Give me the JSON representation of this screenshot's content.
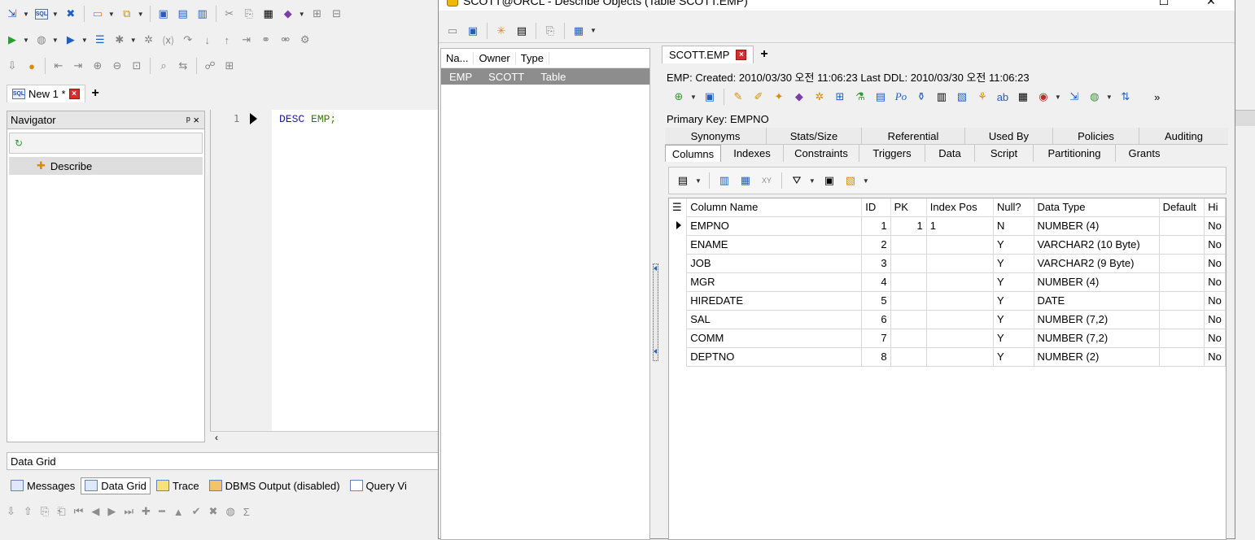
{
  "main": {
    "doc_tab": {
      "label": "New 1 *"
    },
    "navigator": {
      "title": "Navigator",
      "pin": "ᵖ ×",
      "items": [
        {
          "label": "Describe"
        }
      ]
    },
    "editor": {
      "line_number": "1",
      "code_keyword": "DESC",
      "code_table": "EMP;"
    },
    "data_grid_label": "Data Grid",
    "bottom_tabs": [
      {
        "label": "Messages"
      },
      {
        "label": "Data Grid"
      },
      {
        "label": "Trace"
      },
      {
        "label": "DBMS Output (disabled)"
      },
      {
        "label": "Query Vi"
      }
    ]
  },
  "describe_window": {
    "title": "SCOTT@ORCL - Describe Objects (Table SCOTT.EMP)",
    "object_list": {
      "headers": [
        "Na...",
        "Owner",
        "Type"
      ],
      "rows": [
        {
          "name": "EMP",
          "owner": "SCOTT",
          "type": "Table"
        }
      ]
    },
    "object_tab": "SCOTT.EMP",
    "info_line": "EMP:  Created: 2010/03/30 오전 11:06:23  Last DDL: 2010/03/30 오전 11:06:23",
    "primary_key": "Primary Key:  EMPNO",
    "tabs_top": [
      "Synonyms",
      "Stats/Size",
      "Referential",
      "Used By",
      "Policies",
      "Auditing"
    ],
    "tabs_bottom": [
      "Columns",
      "Indexes",
      "Constraints",
      "Triggers",
      "Data",
      "Script",
      "Partitioning",
      "Grants"
    ],
    "selected_tab": "Columns",
    "columns_grid": {
      "headers": [
        "Column Name",
        "ID",
        "PK",
        "Index Pos",
        "Null?",
        "Data Type",
        "Default",
        "Hi"
      ],
      "rows": [
        [
          "EMPNO",
          "1",
          "1",
          "1",
          "N",
          "NUMBER (4)",
          "",
          "No"
        ],
        [
          "ENAME",
          "2",
          "",
          "",
          "Y",
          "VARCHAR2 (10 Byte)",
          "",
          "No"
        ],
        [
          "JOB",
          "3",
          "",
          "",
          "Y",
          "VARCHAR2 (9 Byte)",
          "",
          "No"
        ],
        [
          "MGR",
          "4",
          "",
          "",
          "Y",
          "NUMBER (4)",
          "",
          "No"
        ],
        [
          "HIREDATE",
          "5",
          "",
          "",
          "Y",
          "DATE",
          "",
          "No"
        ],
        [
          "SAL",
          "6",
          "",
          "",
          "Y",
          "NUMBER (7,2)",
          "",
          "No"
        ],
        [
          "COMM",
          "7",
          "",
          "",
          "Y",
          "NUMBER (7,2)",
          "",
          "No"
        ],
        [
          "DEPTNO",
          "8",
          "",
          "",
          "Y",
          "NUMBER (2)",
          "",
          "No"
        ]
      ]
    }
  }
}
